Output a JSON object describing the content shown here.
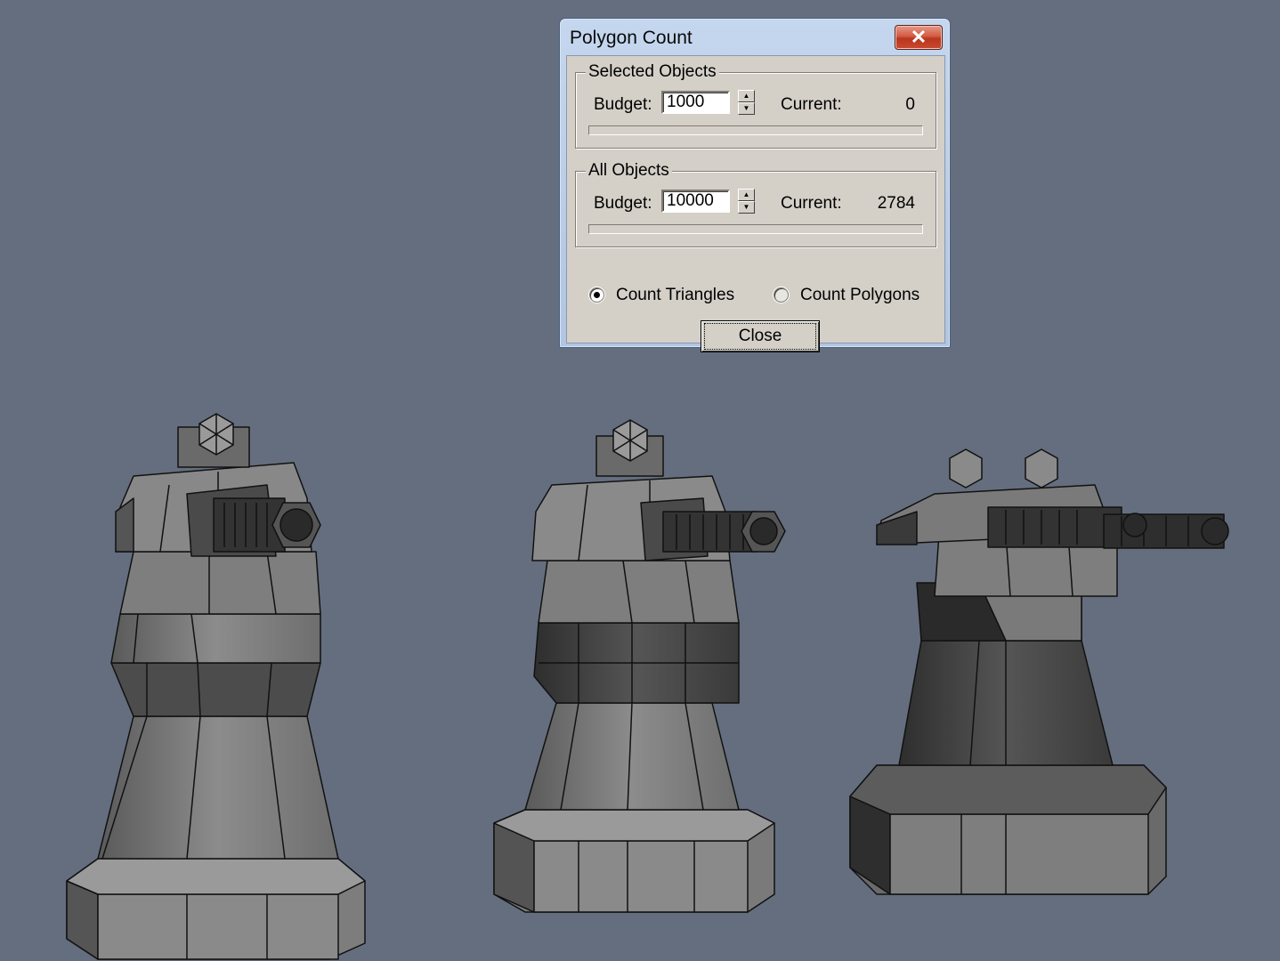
{
  "dialog": {
    "title": "Polygon Count",
    "close_glyph": "✕",
    "selected": {
      "legend": "Selected Objects",
      "budget_label": "Budget:",
      "budget_value": "1000",
      "current_label": "Current:",
      "current_value": "0",
      "progress_fraction": 0
    },
    "all": {
      "legend": "All Objects",
      "budget_label": "Budget:",
      "budget_value": "10000",
      "current_label": "Current:",
      "current_value": "2784",
      "progress_fraction": 0
    },
    "radio_triangles": "Count Triangles",
    "radio_polygons": "Count Polygons",
    "radio_selected": "triangles",
    "close_button": "Close",
    "spin_up": "▲",
    "spin_down": "▼"
  },
  "colors": {
    "viewport_bg": "#646e7e",
    "title_close": "#c9492f",
    "model_light": "#8a8a8a",
    "model_dark": "#3a3a3a"
  }
}
